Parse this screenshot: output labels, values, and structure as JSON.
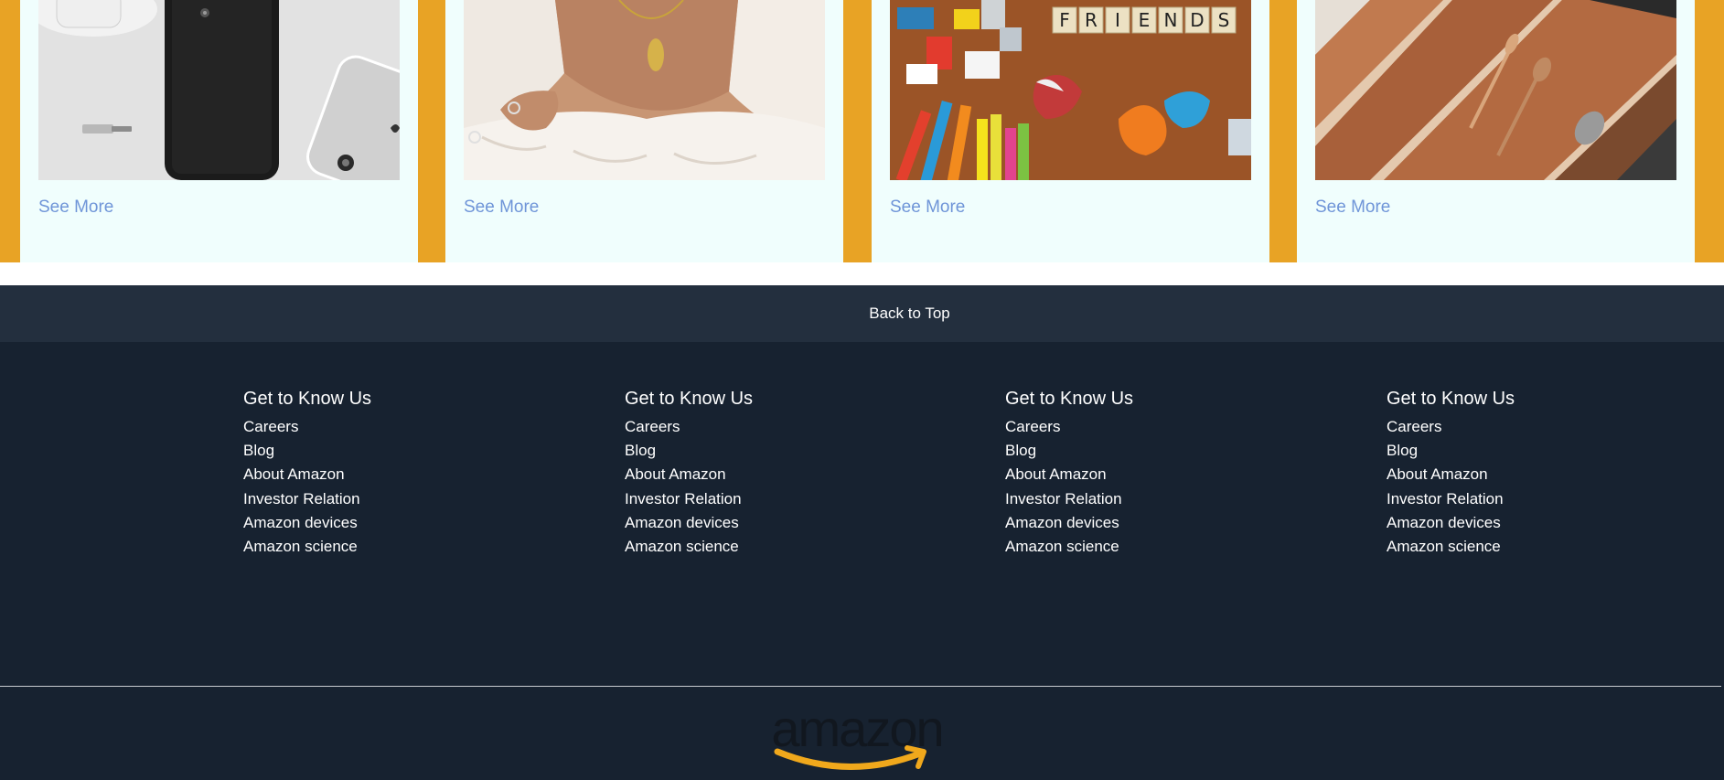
{
  "cards": [
    {
      "image_alt": "black and silver smartphones on white surface",
      "link_label": "See More"
    },
    {
      "image_alt": "woman wearing gold necklace and rings",
      "link_label": "See More"
    },
    {
      "image_alt": "toys, crayons and FRIENDS letter tiles",
      "link_label": "See More"
    },
    {
      "image_alt": "wooden drawer organizer with cutlery",
      "link_label": "See More"
    }
  ],
  "back_to_top": "Back to Top",
  "footer": {
    "columns": [
      {
        "heading": "Get to Know Us",
        "links": [
          "Careers",
          "Blog",
          "About Amazon",
          "Investor Relation",
          "Amazon devices",
          "Amazon science"
        ]
      },
      {
        "heading": "Get to Know Us",
        "links": [
          "Careers",
          "Blog",
          "About Amazon",
          "Investor Relation",
          "Amazon devices",
          "Amazon science"
        ]
      },
      {
        "heading": "Get to Know Us",
        "links": [
          "Careers",
          "Blog",
          "About Amazon",
          "Investor Relation",
          "Amazon devices",
          "Amazon science"
        ]
      },
      {
        "heading": "Get to Know Us",
        "links": [
          "Careers",
          "Blog",
          "About Amazon",
          "Investor Relation",
          "Amazon devices",
          "Amazon science"
        ]
      }
    ],
    "logo_text": "amazon"
  },
  "colors": {
    "strip_accent": "#e8a325",
    "card_bg": "#f0fefd",
    "link": "#6f95d8",
    "back_to_top_bg": "#232f3e",
    "footer_bg": "#172230",
    "logo_smile": "#f0a81c"
  },
  "tile_letters": [
    "F",
    "R",
    "I",
    "E",
    "N",
    "D",
    "S"
  ]
}
